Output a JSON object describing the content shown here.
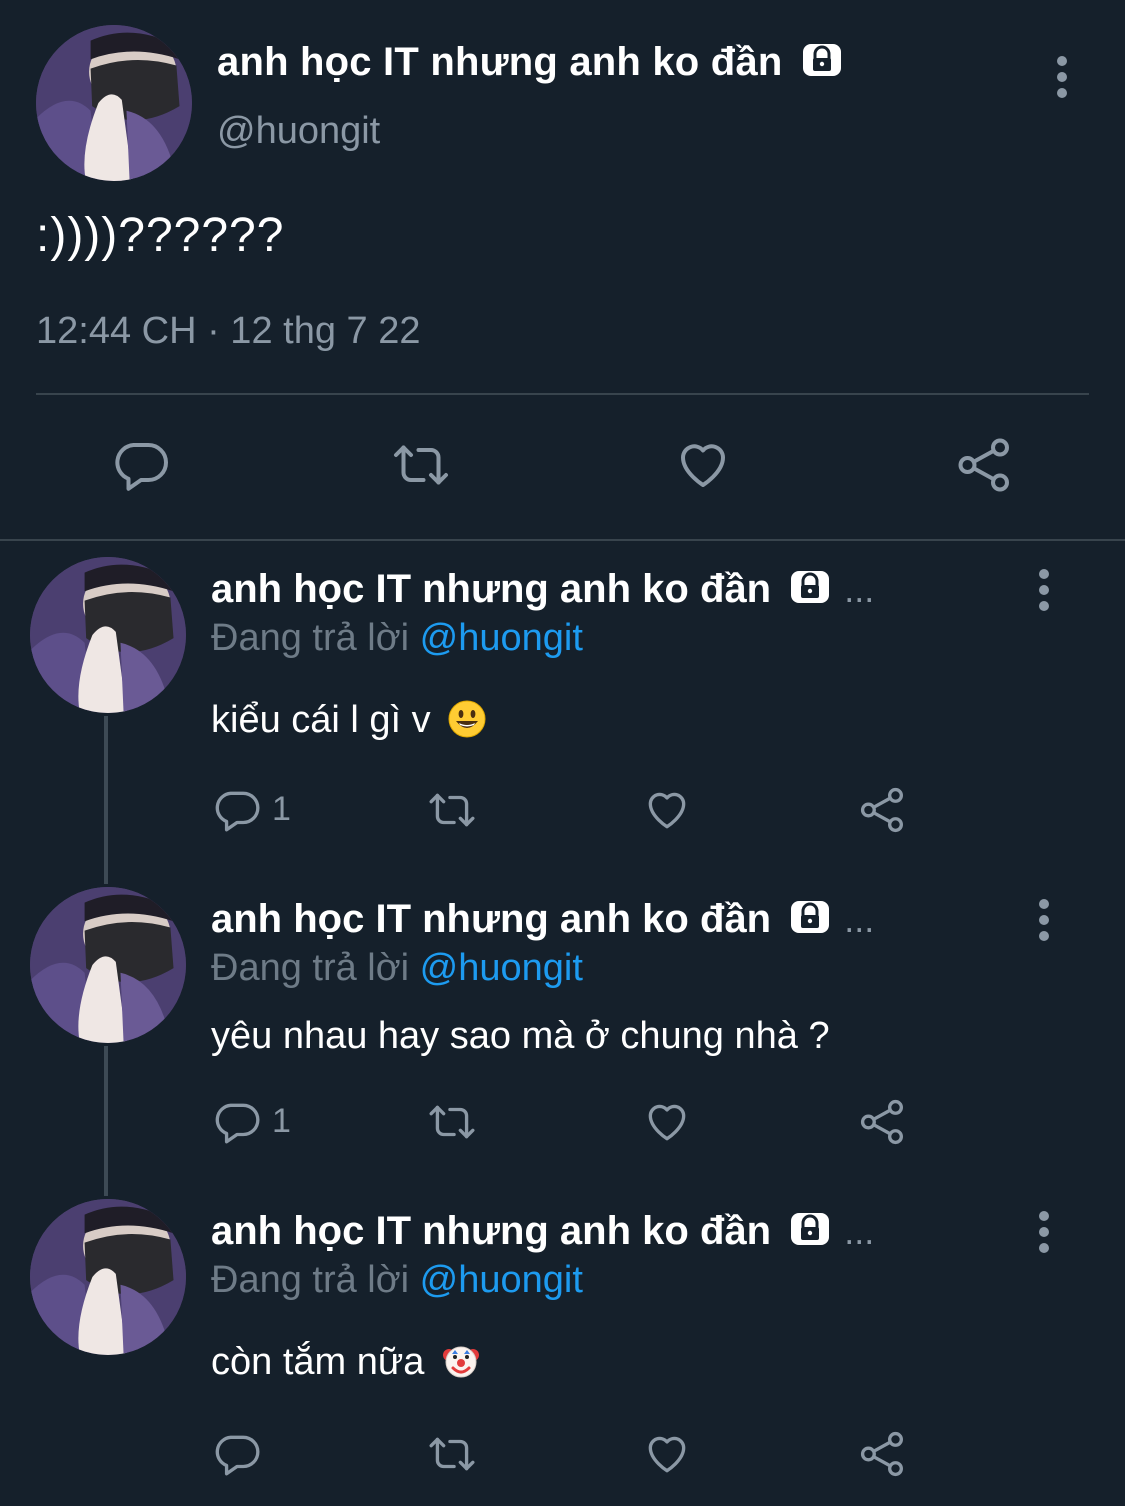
{
  "main_tweet": {
    "display_name": "anh học IT nhưng anh ko đần",
    "handle": "@huongit",
    "text": ":))))??????",
    "timestamp": "12:44 CH · 12 thg 7 22",
    "icons": {
      "more": "more-vertical-icon",
      "lock": "lock-icon",
      "reply": "reply-icon",
      "retweet": "retweet-icon",
      "like": "like-icon",
      "share": "share-icon"
    }
  },
  "replies": [
    {
      "display_name": "anh học IT nhưng anh ko đần",
      "ellipsis": "...",
      "replying_label": "Đang trả lời",
      "replying_to": "@huongit",
      "text": "kiểu cái l gì v",
      "emoji": "smiley-face-emoji",
      "reply_count": "1"
    },
    {
      "display_name": "anh học IT nhưng anh ko đần",
      "ellipsis": "...",
      "replying_label": "Đang trả lời",
      "replying_to": "@huongit",
      "text": "yêu nhau hay sao mà ở chung nhà ?",
      "emoji": "",
      "reply_count": "1"
    },
    {
      "display_name": "anh học IT nhưng anh ko đần",
      "ellipsis": "...",
      "replying_label": "Đang trả lời",
      "replying_to": "@huongit",
      "text": "còn tắm nữa",
      "emoji": "clown-face-emoji",
      "reply_count": ""
    }
  ],
  "colors": {
    "background": "#15202b",
    "text": "#ffffff",
    "secondary": "#8b98a5",
    "link": "#1d9bf0",
    "divider": "#38444d"
  }
}
